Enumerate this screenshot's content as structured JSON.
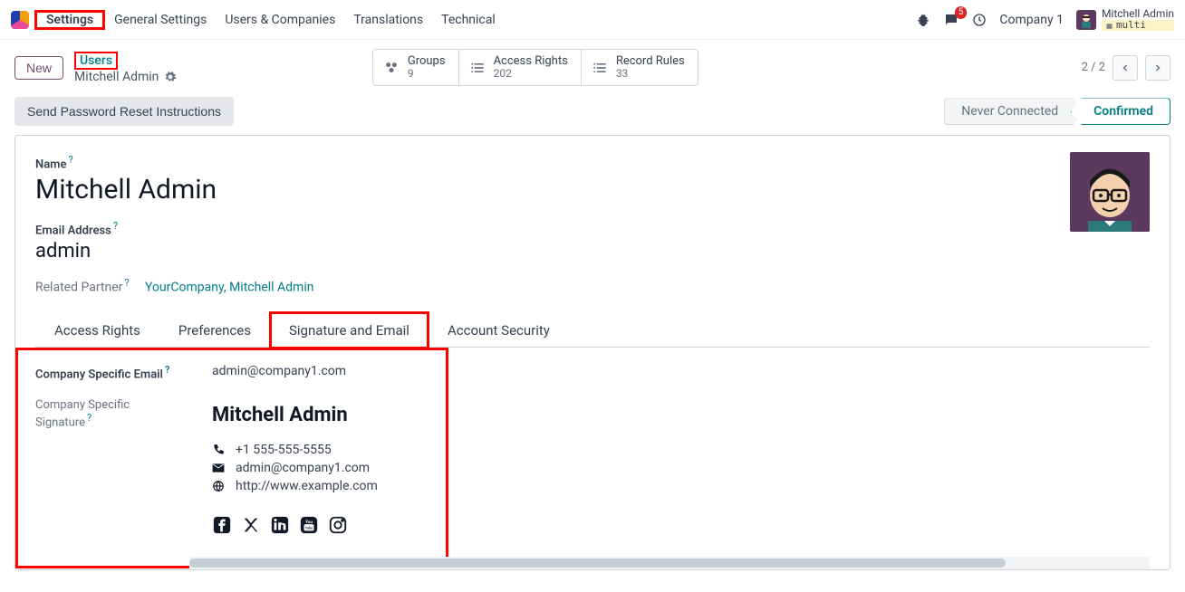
{
  "topnav": {
    "items": [
      "Settings",
      "General Settings",
      "Users & Companies",
      "Translations",
      "Technical"
    ],
    "company": "Company 1",
    "user_name": "Mitchell Admin",
    "multi_label": "multi",
    "msg_count": "5"
  },
  "controlbar": {
    "new_label": "New",
    "breadcrumb_parent": "Users",
    "breadcrumb_current": "Mitchell Admin",
    "stats": [
      {
        "label": "Groups",
        "value": "9"
      },
      {
        "label": "Access Rights",
        "value": "202"
      },
      {
        "label": "Record Rules",
        "value": "33"
      }
    ],
    "pager": "2 / 2"
  },
  "actions": {
    "reset_pw": "Send Password Reset Instructions",
    "status_never": "Never Connected",
    "status_confirmed": "Confirmed"
  },
  "form": {
    "name_label": "Name",
    "name_value": "Mitchell Admin",
    "email_label": "Email Address",
    "email_value": "admin",
    "partner_label": "Related Partner",
    "partner_value": "YourCompany, Mitchell Admin",
    "tabs": [
      "Access Rights",
      "Preferences",
      "Signature and Email",
      "Account Security"
    ],
    "company_email_label": "Company Specific Email",
    "company_email_value": "admin@company1.com",
    "company_sig_label": "Company Specific Signature",
    "sig": {
      "name": "Mitchell Admin",
      "phone": "+1 555-555-5555",
      "email": "admin@company1.com",
      "web": "http://www.example.com"
    }
  }
}
